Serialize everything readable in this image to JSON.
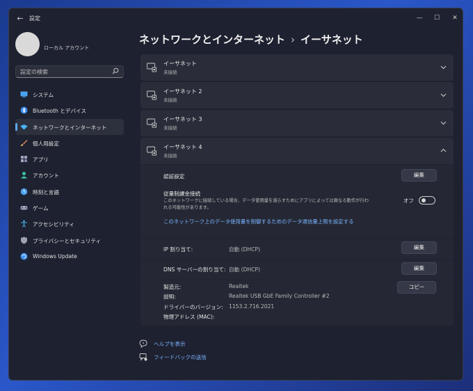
{
  "window": {
    "title": "設定",
    "back_glyph": "←",
    "controls": {
      "minimize": "—",
      "maximize": "☐",
      "close": "✕"
    }
  },
  "account": {
    "name": "ローカル アカウント"
  },
  "search": {
    "placeholder": "設定の検索",
    "icon": "search-icon"
  },
  "sidebar": {
    "items": [
      {
        "label": "システム",
        "icon": "monitor-icon",
        "color": "#4aa3f0"
      },
      {
        "label": "Bluetooth とデバイス",
        "icon": "bluetooth-icon",
        "color": "#3b8be8"
      },
      {
        "label": "ネットワークとインターネット",
        "icon": "wifi-icon",
        "color": "#4ab3f5",
        "active": true
      },
      {
        "label": "個人用設定",
        "icon": "brush-icon",
        "color": "#e0885a"
      },
      {
        "label": "アプリ",
        "icon": "apps-icon",
        "color": "#a0a8c0"
      },
      {
        "label": "アカウント",
        "icon": "person-icon",
        "color": "#37c3a0"
      },
      {
        "label": "時刻と言語",
        "icon": "clock-globe-icon",
        "color": "#4aa3f0"
      },
      {
        "label": "ゲーム",
        "icon": "gamepad-icon",
        "color": "#a0a8c0"
      },
      {
        "label": "アクセシビリティ",
        "icon": "accessibility-icon",
        "color": "#4ab3f5"
      },
      {
        "label": "プライバシーとセキュリティ",
        "icon": "shield-icon",
        "color": "#9aa2b5"
      },
      {
        "label": "Windows Update",
        "icon": "update-icon",
        "color": "#3b8be8"
      }
    ]
  },
  "breadcrumb": {
    "parent": "ネットワークとインターネット",
    "separator": "›",
    "current": "イーサネット"
  },
  "adapters": [
    {
      "name": "イーサネット",
      "status": "未接続",
      "expanded": false
    },
    {
      "name": "イーサネット 2",
      "status": "未接続",
      "expanded": false
    },
    {
      "name": "イーサネット 3",
      "status": "未接続",
      "expanded": false
    },
    {
      "name": "イーサネット 4",
      "status": "未接続",
      "expanded": true
    }
  ],
  "details": {
    "auth": {
      "label": "認証設定",
      "button": "編集"
    },
    "metered": {
      "label": "従量制課金接続",
      "description": "このネットワークに接続している場合、データ使用量を減らすためにアプリによっては異なる動作が行われる可能性があります。",
      "toggle_label": "オフ",
      "toggle_on": false,
      "link": "このネットワーク上のデータ使用量を制御するためのデータ通信量上限を設定する"
    },
    "ip": {
      "label": "IP 割り当て:",
      "value": "自動 (DHCP)",
      "button": "編集"
    },
    "dns": {
      "label": "DNS サーバーの割り当て:",
      "value": "自動 (DHCP)",
      "button": "編集"
    },
    "properties": {
      "copy_button": "コピー",
      "rows": [
        {
          "label": "製造元:",
          "value": "Realtek"
        },
        {
          "label": "説明:",
          "value": "Realtek USB GbE Family Controller #2"
        },
        {
          "label": "ドライバーのバージョン:",
          "value": "1153.2.716.2021"
        },
        {
          "label": "物理アドレス (MAC):",
          "value": ""
        }
      ]
    }
  },
  "footer": {
    "help": "ヘルプを表示",
    "feedback": "フィードバックの送信"
  },
  "colors": {
    "accent": "#5aa9f0",
    "link": "#7ab4ff",
    "window_bg": "#1e2130",
    "card_bg": "#2a2d39"
  }
}
